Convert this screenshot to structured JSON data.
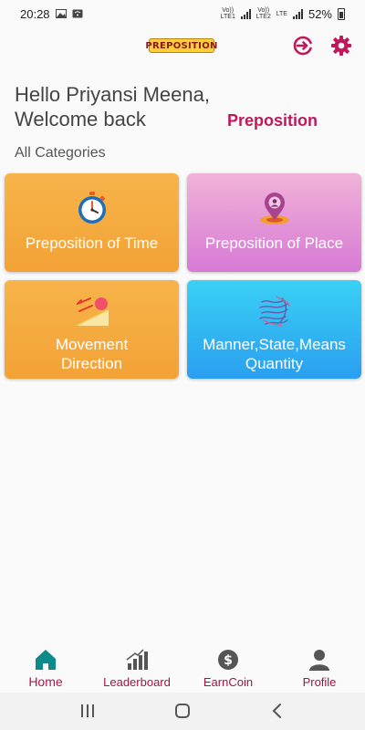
{
  "status_bar": {
    "time": "20:28",
    "sim1_label": "Vo)) LTE1",
    "sim2_label": "Vo)) LTE2",
    "sim2_network": "LTE",
    "battery": "52%"
  },
  "header": {
    "logo_text": "PREPOSITION",
    "logout_icon": "logout-icon",
    "settings_icon": "gear-icon"
  },
  "greeting": {
    "line1": "Hello Priyansi Meena,",
    "line2": "Welcome back"
  },
  "app_title": "Preposition",
  "section_label": "All Categories",
  "categories": [
    {
      "label": "Preposition of Time",
      "icon": "stopwatch-icon"
    },
    {
      "label": "Preposition of Place",
      "icon": "location-pin-icon"
    },
    {
      "label": "Movement Direction",
      "icon": "ball-ramp-icon"
    },
    {
      "label": "Manner,State,Means Quantity",
      "icon": "scribble-icon"
    }
  ],
  "bottom_nav": [
    {
      "label": "Home",
      "icon": "home-icon",
      "active": true
    },
    {
      "label": "Leaderboard",
      "icon": "leaderboard-icon",
      "active": false
    },
    {
      "label": "EarnCoin",
      "icon": "coin-icon",
      "active": false
    },
    {
      "label": "Profile",
      "icon": "profile-icon",
      "active": false
    }
  ],
  "colors": {
    "accent": "#c2185b",
    "home_icon": "#0d8a8a",
    "card_orange": "#f5a940",
    "card_pink": "#e393d8",
    "card_blue": "#30b8f3"
  }
}
